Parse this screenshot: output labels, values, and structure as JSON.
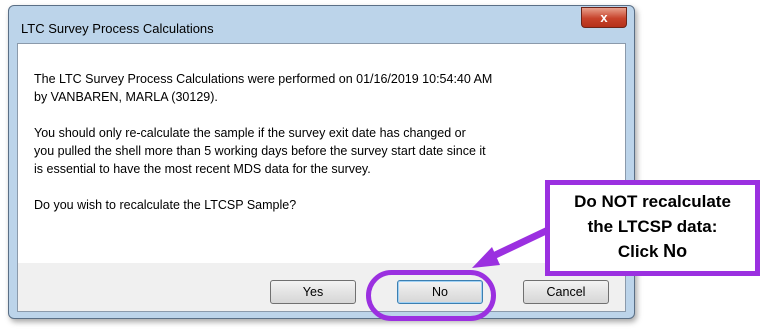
{
  "dialog": {
    "title": "LTC Survey Process Calculations",
    "close_label": "x",
    "message": {
      "line1": "The LTC Survey Process Calculations were performed on 01/16/2019 10:54:40 AM",
      "line2": "by VANBAREN, MARLA (30129).",
      "line3": "You should only re-calculate the sample if the survey exit date has changed or",
      "line4": "you pulled the shell more than 5 working days before the survey start date since it",
      "line5": "is essential to have the most recent MDS data for the survey.",
      "line6": "Do you wish to recalculate the LTCSP Sample?"
    },
    "buttons": {
      "yes": "Yes",
      "no": "No",
      "cancel": "Cancel"
    }
  },
  "callout": {
    "line1": "Do NOT recalculate",
    "line2": "the LTCSP data:",
    "line3_prefix": "Click ",
    "line3_emphasis": "No"
  },
  "colors": {
    "accent": "#9b30e0"
  }
}
